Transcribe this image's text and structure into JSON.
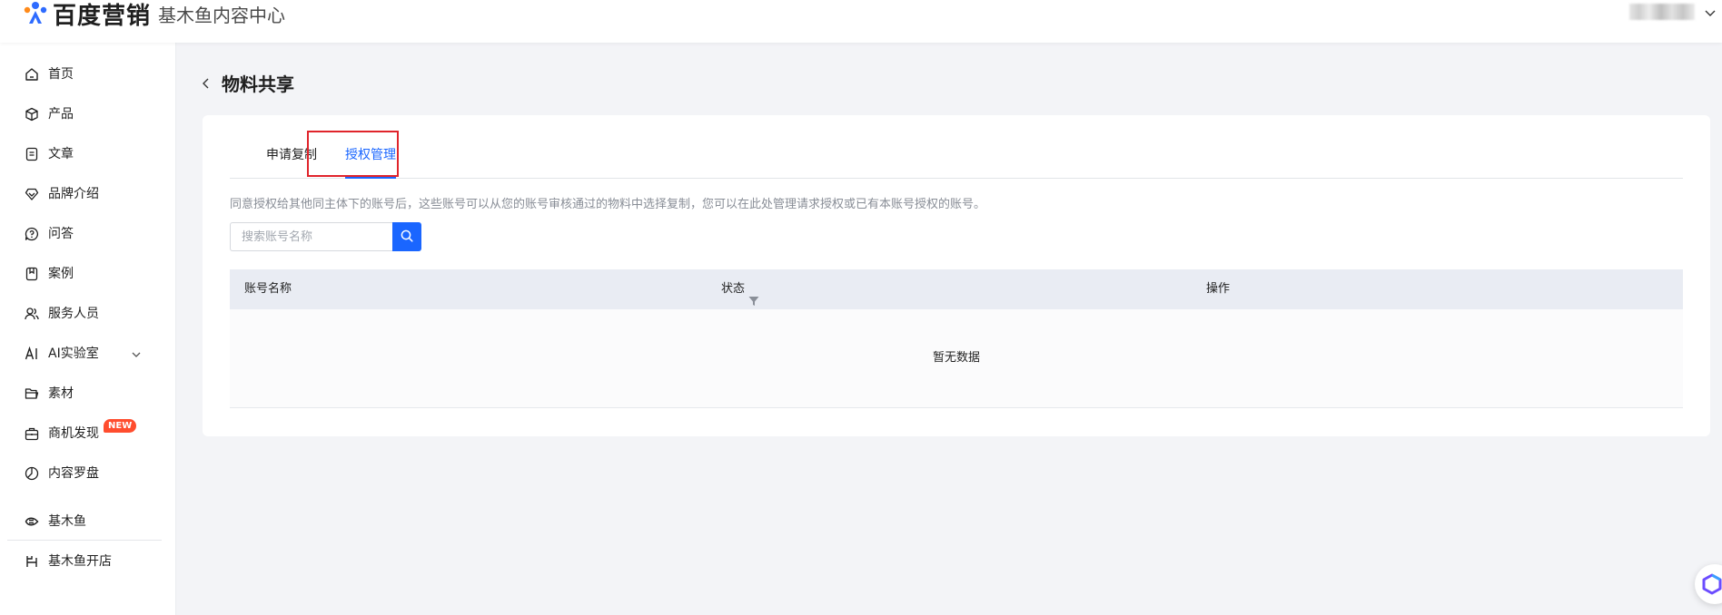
{
  "header": {
    "brand": "百度营销",
    "product": "基木鱼内容中心"
  },
  "sidebar": {
    "items": [
      {
        "label": "首页",
        "icon": "home-icon"
      },
      {
        "label": "产品",
        "icon": "cube-icon"
      },
      {
        "label": "文章",
        "icon": "document-icon"
      },
      {
        "label": "品牌介绍",
        "icon": "diamond-icon"
      },
      {
        "label": "问答",
        "icon": "question-chat-icon"
      },
      {
        "label": "案例",
        "icon": "bookmark-icon"
      },
      {
        "label": "服务人员",
        "icon": "people-icon"
      },
      {
        "label": "AI实验室",
        "icon": "ai-icon"
      },
      {
        "label": "素材",
        "icon": "folder-icon"
      },
      {
        "label": "商机发现",
        "icon": "briefcase-icon",
        "badge": "NEW"
      },
      {
        "label": "内容罗盘",
        "icon": "pie-chart-icon"
      },
      {
        "label": "基木鱼",
        "icon": "jimuyu-logo-icon"
      },
      {
        "label": "基木鱼开店",
        "icon": "shop-icon"
      }
    ]
  },
  "page": {
    "title": "物料共享"
  },
  "tabs": [
    {
      "label": "申请复制",
      "active": false
    },
    {
      "label": "授权管理",
      "active": true
    }
  ],
  "description": "同意授权给其他同主体下的账号后，这些账号可以从您的账号审核通过的物料中选择复制，您可以在此处管理请求授权或已有本账号授权的账号。",
  "search": {
    "placeholder": "搜索账号名称",
    "value": ""
  },
  "table": {
    "columns": [
      "账号名称",
      "状态",
      "操作"
    ],
    "rows": [],
    "empty_text": "暂无数据"
  },
  "colors": {
    "accent": "#1a66ff",
    "highlight_box": "#e0242b",
    "badge": "#ff4d2e",
    "table_header_bg": "#e9ecf3"
  }
}
